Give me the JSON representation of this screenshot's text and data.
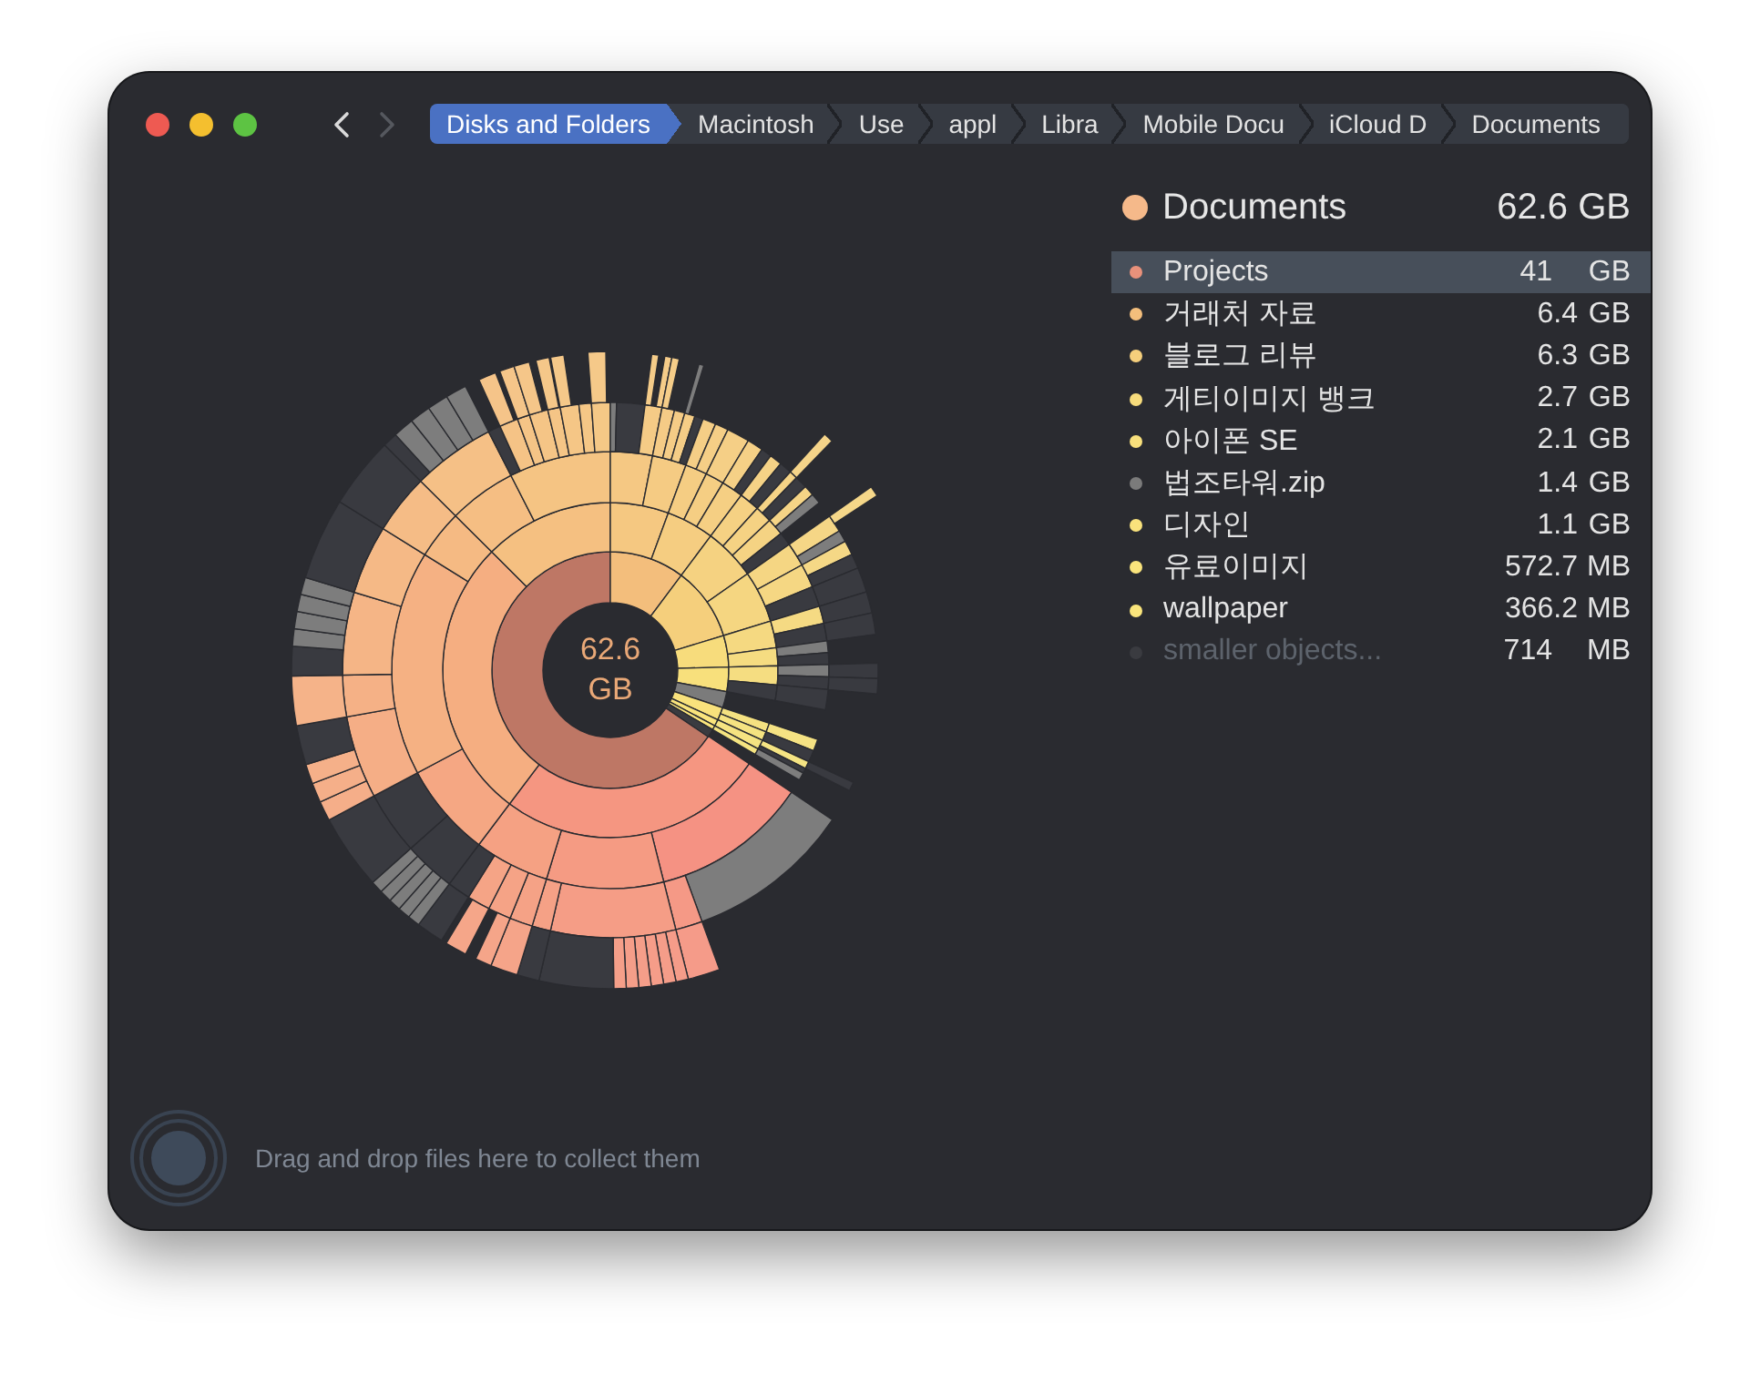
{
  "navigation": {
    "back": {
      "disabled": false
    },
    "forward": {
      "disabled": true
    }
  },
  "breadcrumbs": [
    {
      "label": "Disks and Folders",
      "selected": true
    },
    {
      "label": "Macintosh",
      "selected": false
    },
    {
      "label": "Use",
      "selected": false
    },
    {
      "label": "appl",
      "selected": false
    },
    {
      "label": "Libra",
      "selected": false
    },
    {
      "label": "Mobile Docu",
      "selected": false
    },
    {
      "label": "iCloud D",
      "selected": false
    },
    {
      "label": "Documents",
      "selected": false
    }
  ],
  "folder": {
    "name": "Documents",
    "size": "62.6 GB"
  },
  "items": [
    {
      "name": "Projects",
      "size": "41",
      "unit": "GB",
      "color": "#e8917b",
      "selected": true,
      "dimmed": false
    },
    {
      "name": "거래처 자료",
      "size": "6.4",
      "unit": "GB",
      "color": "#f3be7c",
      "selected": false,
      "dimmed": false
    },
    {
      "name": "블로그 리뷰",
      "size": "6.3",
      "unit": "GB",
      "color": "#f5cf7c",
      "selected": false,
      "dimmed": false
    },
    {
      "name": "게티이미지 뱅크",
      "size": "2.7",
      "unit": "GB",
      "color": "#f7dc7c",
      "selected": false,
      "dimmed": false
    },
    {
      "name": "아이폰 SE",
      "size": "2.1",
      "unit": "GB",
      "color": "#f8e07c",
      "selected": false,
      "dimmed": false
    },
    {
      "name": "법조타워.zip",
      "size": "1.4",
      "unit": "GB",
      "color": "#7b7b7b",
      "selected": false,
      "dimmed": false
    },
    {
      "name": "디자인",
      "size": "1.1",
      "unit": "GB",
      "color": "#f9e27c",
      "selected": false,
      "dimmed": false
    },
    {
      "name": "유료이미지",
      "size": "572.7",
      "unit": "MB",
      "color": "#fae47c",
      "selected": false,
      "dimmed": false
    },
    {
      "name": "wallpaper",
      "size": "366.2",
      "unit": "MB",
      "color": "#fae57c",
      "selected": false,
      "dimmed": false
    },
    {
      "name": "smaller objects...",
      "size": "714",
      "unit": "MB",
      "color": "#3a3b40",
      "selected": false,
      "dimmed": true
    }
  ],
  "chart": {
    "center_label": "62.6 GB"
  },
  "drop_zone": {
    "text": "Drag and drop files here to collect them"
  }
}
